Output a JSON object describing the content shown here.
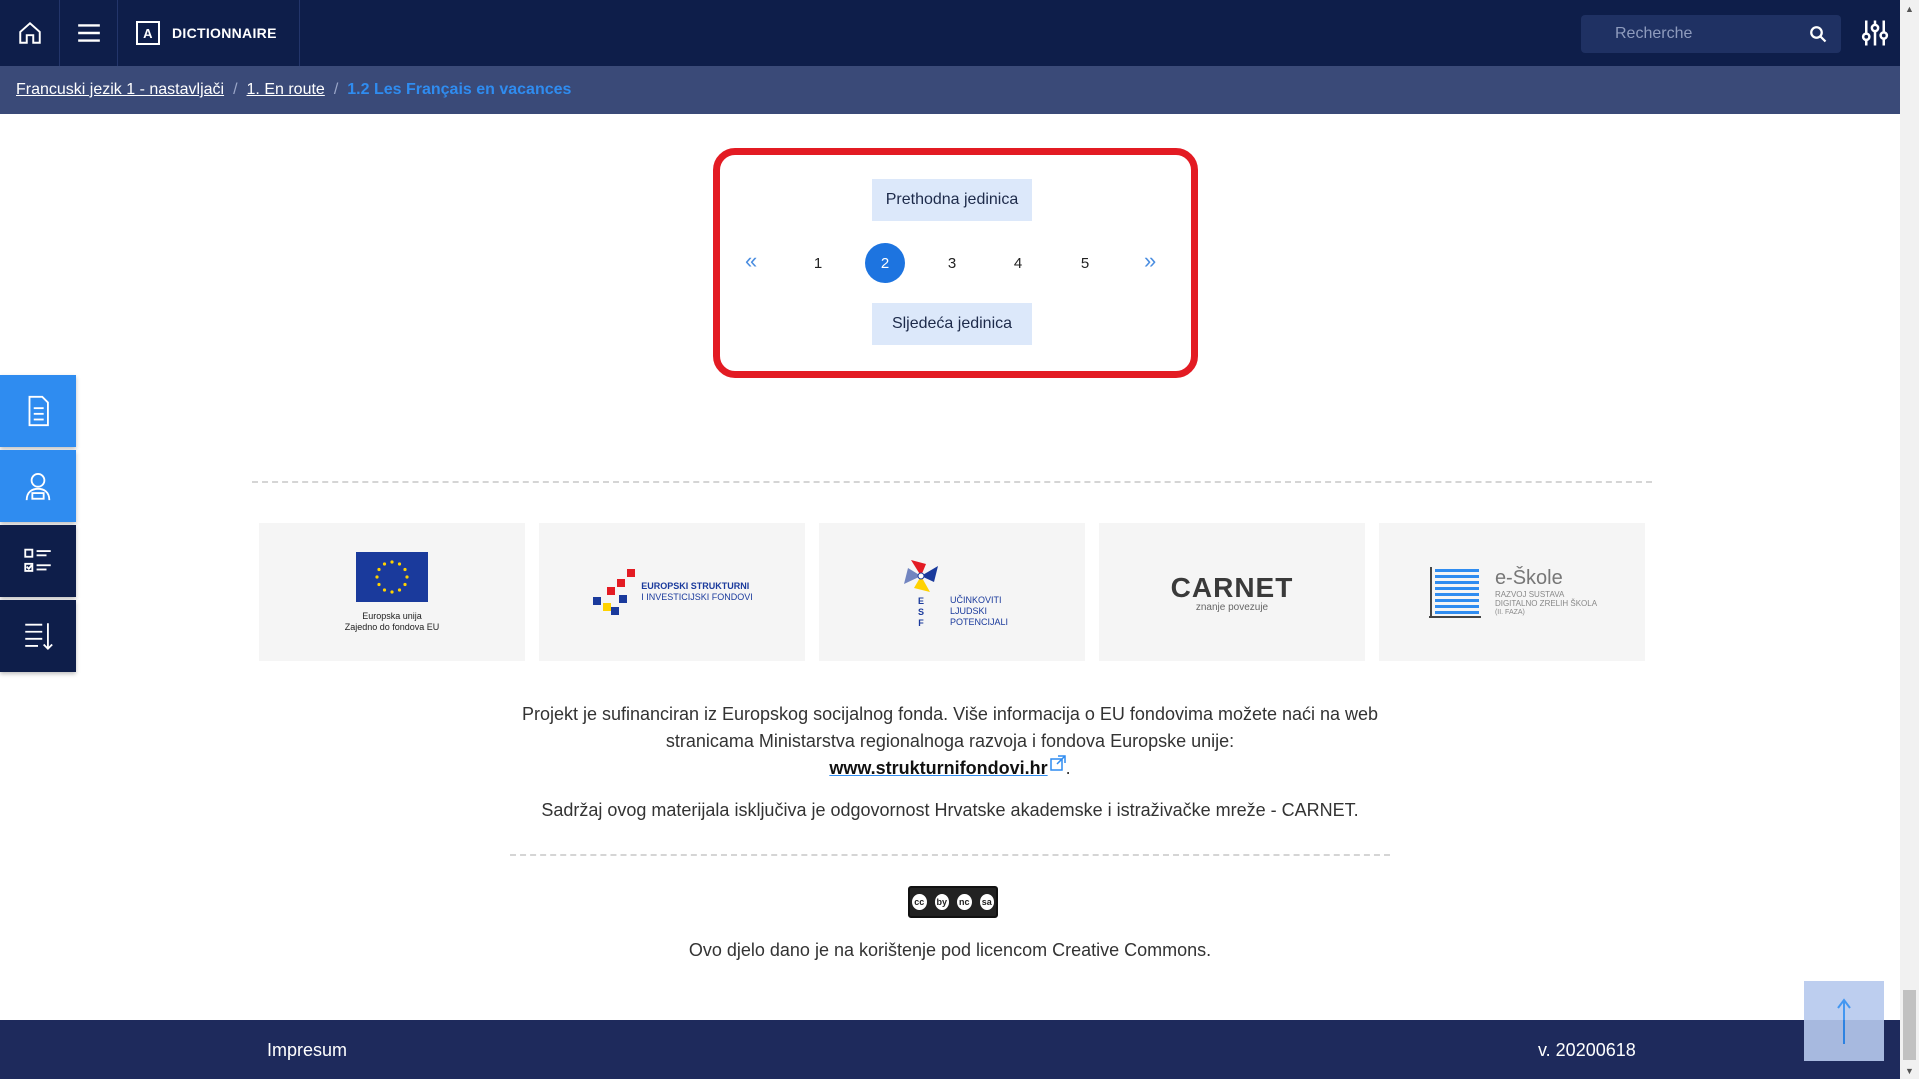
{
  "header": {
    "dictionary_label": "DICTIONNAIRE",
    "dictionary_icon_letter": "A",
    "search_placeholder": "Recherche"
  },
  "breadcrumb": {
    "items": [
      "Francuski jezik 1 - nastavljači",
      "1. En route"
    ],
    "current": "1.2 Les Français en vacances"
  },
  "pagination": {
    "prev_label": "Prethodna jedinica",
    "next_label": "Sljedeća jedinica",
    "first_arrow": "«",
    "last_arrow": "»",
    "pages": [
      "1",
      "2",
      "3",
      "4",
      "5"
    ],
    "active_page": "2"
  },
  "logos": {
    "eu_line1": "Europska unija",
    "eu_line2": "Zajedno do fondova EU",
    "esi_line1": "EUROPSKI STRUKTURNI",
    "esi_line2": "I INVESTICIJSKI FONDOVI",
    "esf_letters": [
      "E",
      "S",
      "F"
    ],
    "esf_line1": "UČINKOVITI",
    "esf_line2": "LJUDSKI",
    "esf_line3": "POTENCIJALI",
    "carnet_name": "CARNET",
    "carnet_tag": "znanje povezuje",
    "eskole_name": "e-Škole",
    "eskole_line1": "RAZVOJ SUSTAVA",
    "eskole_line2": "DIGITALNO ZRELIH ŠKOLA",
    "eskole_line3": "(II. FAZA)"
  },
  "footer_text": {
    "para1_a": "Projekt je sufinanciran iz Europskog socijalnog fonda. Više informacija o EU fondovima možete naći na web",
    "para1_b": "stranicama Ministarstva regionalnoga razvoja i fondova Europske unije:",
    "link": "www.strukturnifondovi.hr",
    "link_suffix": ".",
    "para2": "Sadržaj ovog materijala isključiva je odgovornost Hrvatske akademske i istraživačke mreže - CARNET.",
    "license": "Ovo djelo dano je na korištenje pod licencom Creative Commons.",
    "cc_badge": [
      "cc",
      "by",
      "nc",
      "sa"
    ]
  },
  "bottom": {
    "impresum": "Impresum",
    "version": "v. 20200618"
  },
  "colors": {
    "header": "#0e1e4a",
    "breadcrumb": "#3a4a78",
    "accent": "#1d74e0",
    "highlight": "#e31b23"
  }
}
